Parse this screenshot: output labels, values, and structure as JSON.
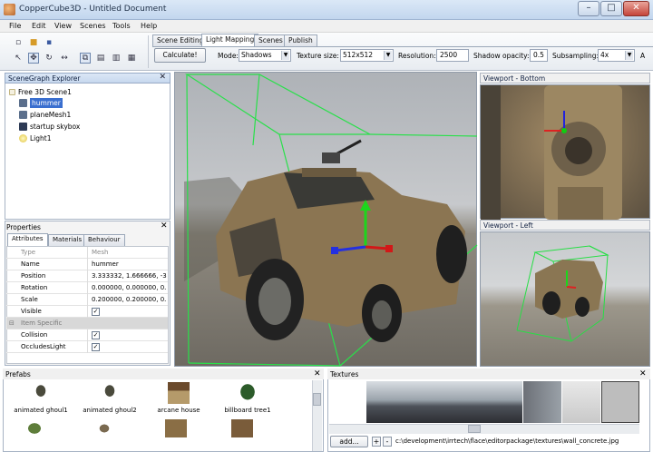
{
  "window": {
    "title": "CopperCube3D - Untitled Document"
  },
  "menu": [
    "File",
    "Edit",
    "View",
    "Scenes",
    "Tools",
    "Help"
  ],
  "tabs": [
    "Scene Editing",
    "Light Mapping",
    "Scenes",
    "Publish"
  ],
  "lightmap": {
    "calculate": "Calculate!",
    "mode_label": "Mode:",
    "mode_value": "Shadows",
    "texsize_label": "Texture size:",
    "texsize_value": "512x512",
    "resolution_label": "Resolution:",
    "resolution_value": "2500",
    "opacity_label": "Shadow opacity:",
    "opacity_value": "0.5",
    "subsampling_label": "Subsampling:",
    "subsampling_value": "4x",
    "trailing": "A"
  },
  "scenegraph": {
    "title": "SceneGraph Explorer",
    "root": "Free 3D Scene1",
    "items": [
      "hummer",
      "planeMesh1",
      "startup skybox",
      "Light1"
    ]
  },
  "properties": {
    "title": "Properties",
    "tabs": [
      "Attributes",
      "Materials",
      "Behaviour"
    ],
    "rows": [
      {
        "k": "Type",
        "v": "Mesh"
      },
      {
        "k": "Name",
        "v": "hummer"
      },
      {
        "k": "Position",
        "v": "3.333332, 1.666666, -3"
      },
      {
        "k": "Rotation",
        "v": "0.000000, 0.000000, 0."
      },
      {
        "k": "Scale",
        "v": "0.200000, 0.200000, 0."
      }
    ],
    "visible_label": "Visible",
    "section": "Item Specific",
    "collision_label": "Collision",
    "occludes_label": "OccludesLight",
    "check": "✓"
  },
  "viewports": {
    "bottom": "Viewport - Bottom",
    "left": "Viewport - Left"
  },
  "prefabs": {
    "title": "Prefabs",
    "items": [
      "animated ghoul1",
      "animated ghoul2",
      "arcane house",
      "billboard tree1"
    ]
  },
  "textures": {
    "title": "Textures",
    "add": "add...",
    "plus": "+",
    "minus": "-",
    "path": "c:\\development\\irrtech\\flace\\editorpackage\\textures\\wall_concrete.jpg"
  },
  "titlebar_buttons": {
    "minimize": "–",
    "maximize": "□",
    "close": "✕"
  },
  "panel_close": "✕"
}
